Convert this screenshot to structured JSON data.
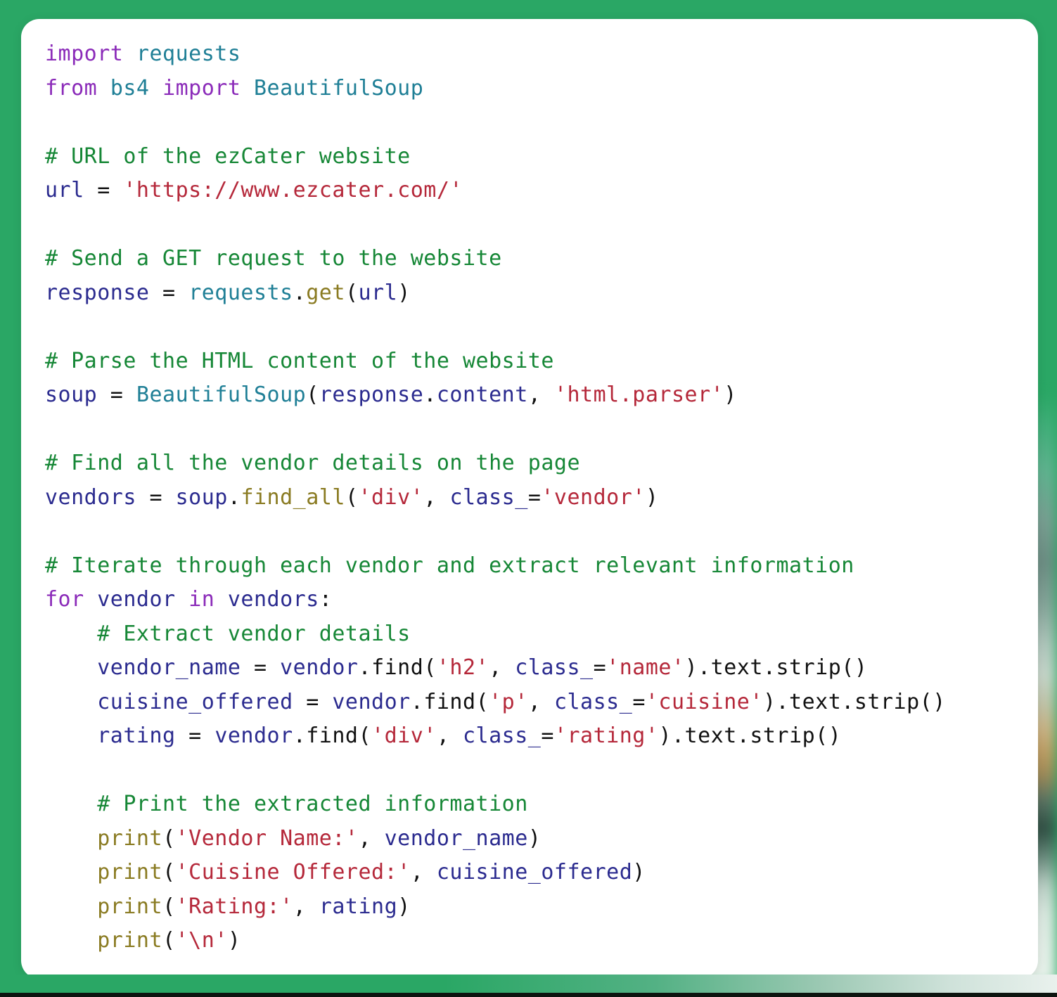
{
  "page": {
    "background_color": "#2aa765",
    "card_background": "#ffffff",
    "language": "python"
  },
  "theme": {
    "keyword_color": "#8b2bb9",
    "module_color": "#1f7f96",
    "comment_color": "#168736",
    "variable_color": "#2b2b8f",
    "string_color": "#b5283a",
    "function_color": "#8a7b22",
    "plain_color": "#111111"
  },
  "code": {
    "lines": [
      [
        {
          "t": "import",
          "c": "kw"
        },
        {
          "t": " ",
          "c": "plain"
        },
        {
          "t": "requests",
          "c": "mod"
        }
      ],
      [
        {
          "t": "from",
          "c": "kw"
        },
        {
          "t": " ",
          "c": "plain"
        },
        {
          "t": "bs4",
          "c": "mod"
        },
        {
          "t": " ",
          "c": "plain"
        },
        {
          "t": "import",
          "c": "kw"
        },
        {
          "t": " ",
          "c": "plain"
        },
        {
          "t": "BeautifulSoup",
          "c": "mod"
        }
      ],
      [],
      [
        {
          "t": "# URL of the ezCater website",
          "c": "comment"
        }
      ],
      [
        {
          "t": "url",
          "c": "var"
        },
        {
          "t": " = ",
          "c": "plain"
        },
        {
          "t": "'https://www.ezcater.com/'",
          "c": "str"
        }
      ],
      [],
      [
        {
          "t": "# Send a GET request to the website",
          "c": "comment"
        }
      ],
      [
        {
          "t": "response",
          "c": "var"
        },
        {
          "t": " = ",
          "c": "plain"
        },
        {
          "t": "requests",
          "c": "mod"
        },
        {
          "t": ".",
          "c": "plain"
        },
        {
          "t": "get",
          "c": "fn"
        },
        {
          "t": "(",
          "c": "plain"
        },
        {
          "t": "url",
          "c": "var"
        },
        {
          "t": ")",
          "c": "plain"
        }
      ],
      [],
      [
        {
          "t": "# Parse the HTML content of the website",
          "c": "comment"
        }
      ],
      [
        {
          "t": "soup",
          "c": "var"
        },
        {
          "t": " = ",
          "c": "plain"
        },
        {
          "t": "BeautifulSoup",
          "c": "mod"
        },
        {
          "t": "(",
          "c": "plain"
        },
        {
          "t": "response",
          "c": "var"
        },
        {
          "t": ".",
          "c": "plain"
        },
        {
          "t": "content",
          "c": "var"
        },
        {
          "t": ", ",
          "c": "plain"
        },
        {
          "t": "'html.parser'",
          "c": "str"
        },
        {
          "t": ")",
          "c": "plain"
        }
      ],
      [],
      [
        {
          "t": "# Find all the vendor details on the page",
          "c": "comment"
        }
      ],
      [
        {
          "t": "vendors",
          "c": "var"
        },
        {
          "t": " = ",
          "c": "plain"
        },
        {
          "t": "soup",
          "c": "var"
        },
        {
          "t": ".",
          "c": "plain"
        },
        {
          "t": "find_all",
          "c": "fn"
        },
        {
          "t": "(",
          "c": "plain"
        },
        {
          "t": "'div'",
          "c": "str"
        },
        {
          "t": ", ",
          "c": "plain"
        },
        {
          "t": "class_",
          "c": "var"
        },
        {
          "t": "=",
          "c": "plain"
        },
        {
          "t": "'vendor'",
          "c": "str"
        },
        {
          "t": ")",
          "c": "plain"
        }
      ],
      [],
      [
        {
          "t": "# Iterate through each vendor and extract relevant information",
          "c": "comment"
        }
      ],
      [
        {
          "t": "for",
          "c": "kw"
        },
        {
          "t": " ",
          "c": "plain"
        },
        {
          "t": "vendor",
          "c": "var"
        },
        {
          "t": " ",
          "c": "plain"
        },
        {
          "t": "in",
          "c": "kw"
        },
        {
          "t": " ",
          "c": "plain"
        },
        {
          "t": "vendors",
          "c": "var"
        },
        {
          "t": ":",
          "c": "plain"
        }
      ],
      [
        {
          "t": "    # Extract vendor details",
          "c": "comment"
        }
      ],
      [
        {
          "t": "    ",
          "c": "plain"
        },
        {
          "t": "vendor_name",
          "c": "var"
        },
        {
          "t": " = ",
          "c": "plain"
        },
        {
          "t": "vendor",
          "c": "var"
        },
        {
          "t": ".",
          "c": "plain"
        },
        {
          "t": "find",
          "c": "plain"
        },
        {
          "t": "(",
          "c": "plain"
        },
        {
          "t": "'h2'",
          "c": "str"
        },
        {
          "t": ", ",
          "c": "plain"
        },
        {
          "t": "class_",
          "c": "var"
        },
        {
          "t": "=",
          "c": "plain"
        },
        {
          "t": "'name'",
          "c": "str"
        },
        {
          "t": ").text.strip()",
          "c": "plain"
        }
      ],
      [
        {
          "t": "    ",
          "c": "plain"
        },
        {
          "t": "cuisine_offered",
          "c": "var"
        },
        {
          "t": " = ",
          "c": "plain"
        },
        {
          "t": "vendor",
          "c": "var"
        },
        {
          "t": ".",
          "c": "plain"
        },
        {
          "t": "find",
          "c": "plain"
        },
        {
          "t": "(",
          "c": "plain"
        },
        {
          "t": "'p'",
          "c": "str"
        },
        {
          "t": ", ",
          "c": "plain"
        },
        {
          "t": "class_",
          "c": "var"
        },
        {
          "t": "=",
          "c": "plain"
        },
        {
          "t": "'cuisine'",
          "c": "str"
        },
        {
          "t": ").text.strip()",
          "c": "plain"
        }
      ],
      [
        {
          "t": "    ",
          "c": "plain"
        },
        {
          "t": "rating",
          "c": "var"
        },
        {
          "t": " = ",
          "c": "plain"
        },
        {
          "t": "vendor",
          "c": "var"
        },
        {
          "t": ".",
          "c": "plain"
        },
        {
          "t": "find",
          "c": "plain"
        },
        {
          "t": "(",
          "c": "plain"
        },
        {
          "t": "'div'",
          "c": "str"
        },
        {
          "t": ", ",
          "c": "plain"
        },
        {
          "t": "class_",
          "c": "var"
        },
        {
          "t": "=",
          "c": "plain"
        },
        {
          "t": "'rating'",
          "c": "str"
        },
        {
          "t": ").text.strip()",
          "c": "plain"
        }
      ],
      [],
      [
        {
          "t": "    # Print the extracted information",
          "c": "comment"
        }
      ],
      [
        {
          "t": "    ",
          "c": "plain"
        },
        {
          "t": "print",
          "c": "fn"
        },
        {
          "t": "(",
          "c": "plain"
        },
        {
          "t": "'Vendor Name:'",
          "c": "str"
        },
        {
          "t": ", ",
          "c": "plain"
        },
        {
          "t": "vendor_name",
          "c": "var"
        },
        {
          "t": ")",
          "c": "plain"
        }
      ],
      [
        {
          "t": "    ",
          "c": "plain"
        },
        {
          "t": "print",
          "c": "fn"
        },
        {
          "t": "(",
          "c": "plain"
        },
        {
          "t": "'Cuisine Offered:'",
          "c": "str"
        },
        {
          "t": ", ",
          "c": "plain"
        },
        {
          "t": "cuisine_offered",
          "c": "var"
        },
        {
          "t": ")",
          "c": "plain"
        }
      ],
      [
        {
          "t": "    ",
          "c": "plain"
        },
        {
          "t": "print",
          "c": "fn"
        },
        {
          "t": "(",
          "c": "plain"
        },
        {
          "t": "'Rating:'",
          "c": "str"
        },
        {
          "t": ", ",
          "c": "plain"
        },
        {
          "t": "rating",
          "c": "var"
        },
        {
          "t": ")",
          "c": "plain"
        }
      ],
      [
        {
          "t": "    ",
          "c": "plain"
        },
        {
          "t": "print",
          "c": "fn"
        },
        {
          "t": "(",
          "c": "plain"
        },
        {
          "t": "'\\n'",
          "c": "str"
        },
        {
          "t": ")",
          "c": "plain"
        }
      ]
    ]
  }
}
